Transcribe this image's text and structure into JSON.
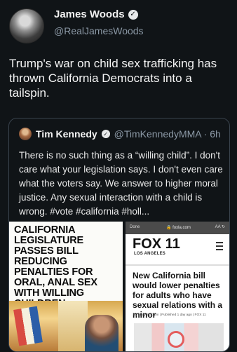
{
  "tweet": {
    "author_name": "James Woods",
    "handle": "@RealJamesWoods",
    "text": "Trump's war on child sex trafficking has thrown California Democrats into a tailspin."
  },
  "quoted_tweet": {
    "author_name": "Tim Kennedy",
    "handle": "@TimKennedyMMA · 6h",
    "text": "There is no such thing as a “willing child”. I don't care what your legislation says. I don't even care what the voters say. We answer to higher moral justice. Any sexual interaction with a child is wrong. #vote #california #holl..."
  },
  "media": {
    "left_headline": "California Legislature Passes Bill Reducing Penalties for Oral, Anal Sex with Willing Children",
    "browser_done": "Done",
    "browser_url": "🔒 foxla.com",
    "browser_icons": "AA ↻",
    "station_logo": "FOX 11",
    "station_city": "LOS ANGELES",
    "right_headline": "New California bill would lower penalties for adults who have sexual relations with a minor",
    "byline": "By Mary Stringini | Published 1 day ago | FOX 11"
  }
}
